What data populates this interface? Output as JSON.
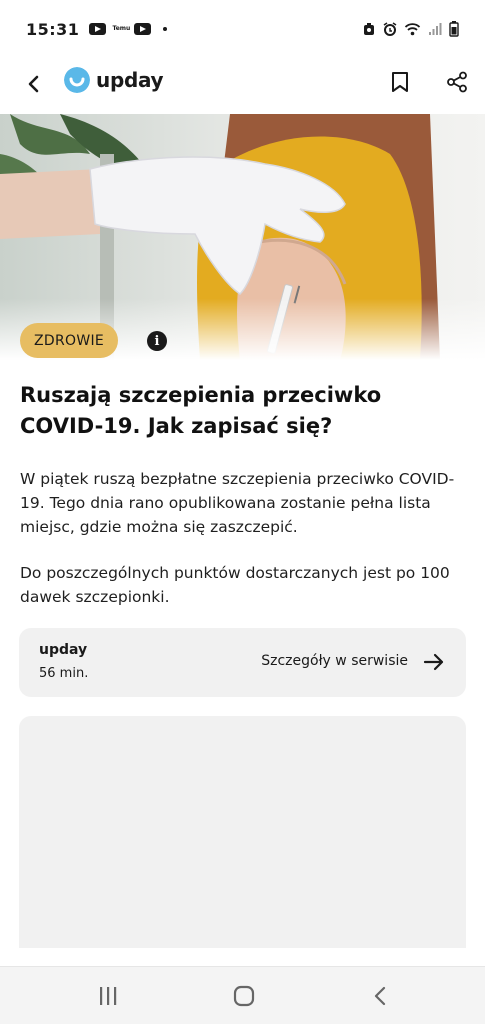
{
  "status_bar": {
    "time": "15:31",
    "temu_label": "Temu",
    "icons": [
      "youtube-icon",
      "temu-icon",
      "youtube-icon",
      "dot-icon",
      "alarm-icon",
      "alarm-clock-icon",
      "wifi-icon",
      "signal-icon",
      "battery-icon"
    ]
  },
  "header": {
    "logo_text": "upday",
    "logo_color": "#5ab8e8",
    "back_icon": "chevron-left-icon",
    "bookmark_icon": "bookmark-icon",
    "share_icon": "share-icon"
  },
  "article": {
    "category": "ZDROWIE",
    "category_color": "#e7bd62",
    "info_glyph": "i",
    "title": "Ruszają szczepienia przeciwko COVID-19. Jak zapisać się?",
    "paragraphs": [
      "W piątek ruszą bezpłatne szczepienia przeciwko COVID-19. Tego dnia rano opublikowana zostanie pełna lista miejsc, gdzie można się zaszczepić.",
      "Do poszczególnych punktów dostarczanych jest po 100 dawek szczepionki."
    ]
  },
  "source_card": {
    "source": "upday",
    "time": "56 min.",
    "link_label": "Szczegóły w serwisie",
    "arrow_icon": "arrow-right-icon"
  },
  "nav_bar": {
    "recents_icon": "recents-icon",
    "home_icon": "home-icon",
    "back_icon": "back-chevron-icon"
  }
}
